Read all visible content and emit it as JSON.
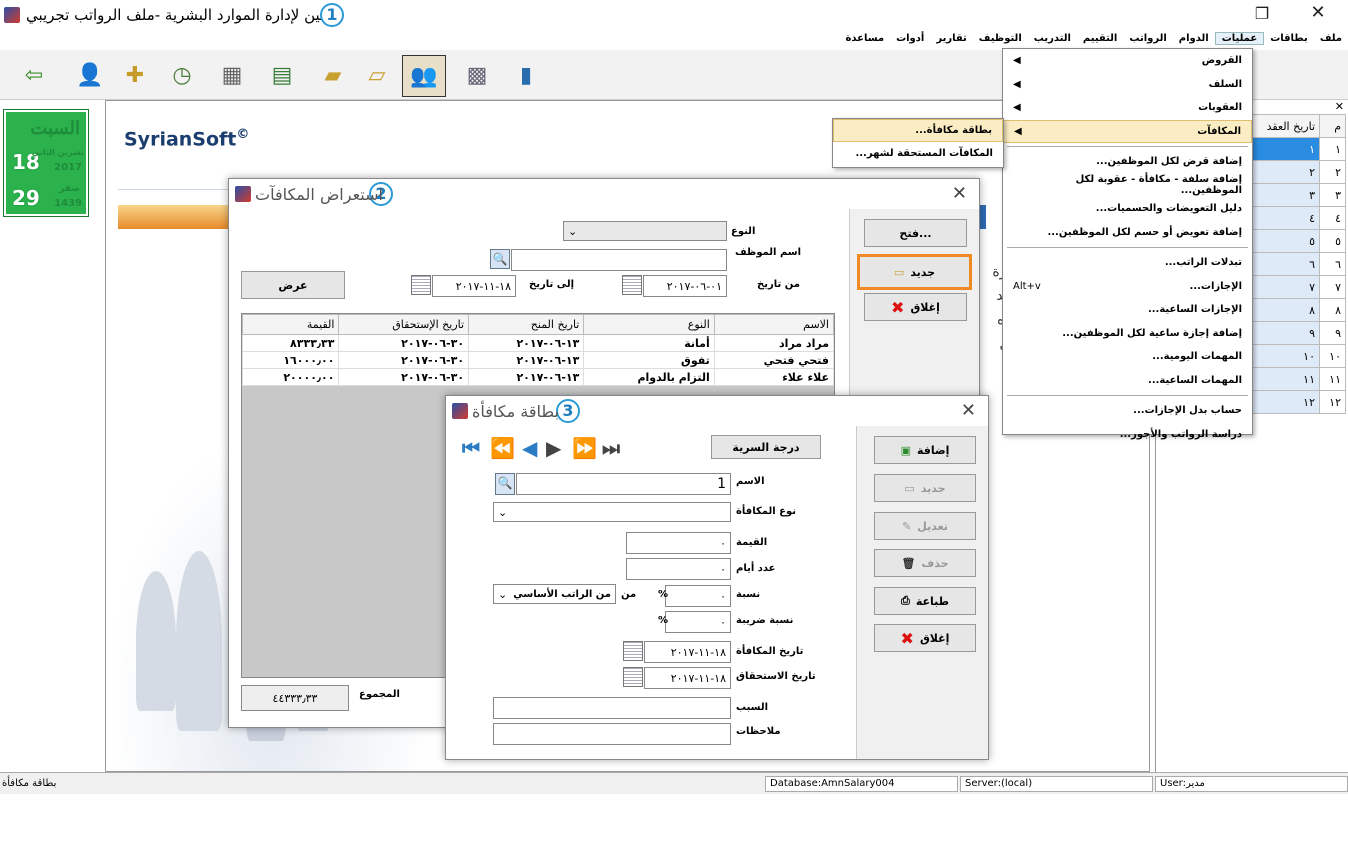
{
  "window": {
    "title": "الأمين لإدارة الموارد البشرية -ملف الرواتب تجريبي",
    "badge": "1"
  },
  "menubar": [
    "ملف",
    "بطاقات",
    "عمليات",
    "الدوام",
    "الرواتب",
    "التقييم",
    "التدريب",
    "التوظيف",
    "تقارير",
    "أدوات",
    "مساعدة"
  ],
  "calendar": {
    "day_name": "السبت",
    "greg_day": "18",
    "greg_month": "تشرين الثاني",
    "greg_year": "2017",
    "hijri_day": "29",
    "hijri_month": "صفر",
    "hijri_year": "1439"
  },
  "brand": {
    "name": "SyrianSoft",
    "mark": "©"
  },
  "ops_menu": {
    "items": [
      {
        "label": "القروض",
        "submenu": true
      },
      {
        "label": "السلف",
        "submenu": true
      },
      {
        "label": "العقوبات",
        "submenu": true
      },
      {
        "label": "المكافآت",
        "submenu": true
      },
      {
        "label": "إضافة قرض لكل الموظفين..."
      },
      {
        "label": "إضافة سلفة - مكافأة - عقوبة لكل الموظفين..."
      },
      {
        "label": "دليل التعويضات والحسميات..."
      },
      {
        "label": "إضافة تعويض أو حسم لكل الموظفين..."
      },
      {
        "label": "تبدلات الراتب..."
      },
      {
        "label": "الإجازات...",
        "shortcut": "Alt+v"
      },
      {
        "label": "الإجازات الساعية..."
      },
      {
        "label": "إضافة إجازة ساعية لكل الموظفين..."
      },
      {
        "label": "المهمات اليومية..."
      },
      {
        "label": "المهمات الساعية..."
      },
      {
        "label": "حساب بدل الإجازات..."
      },
      {
        "label": "دراسة الرواتب والأجور..."
      }
    ]
  },
  "rewards_submenu": [
    "بطاقة مكافأة...",
    "المكافآت المستحقة لشهر..."
  ],
  "right_grid": {
    "headers": [
      "م",
      "تاريخ العقد"
    ],
    "rows": [
      [
        "١",
        "١"
      ],
      [
        "٢",
        "٢"
      ],
      [
        "٣",
        "٣"
      ],
      [
        "٤",
        "٤"
      ],
      [
        "٥",
        "٥"
      ],
      [
        "٦",
        "٦"
      ],
      [
        "٧",
        "٧"
      ],
      [
        "٨",
        "٨"
      ],
      [
        "٩",
        "٩"
      ],
      [
        "١٠",
        "١٠"
      ],
      [
        "١١",
        "١١"
      ],
      [
        "١٢",
        "١٢"
      ]
    ]
  },
  "browse_dialog": {
    "title": "استعراض المكافآت",
    "badge": "2",
    "labels": {
      "type": "النوع",
      "employee": "اسم الموظف",
      "from_date": "من تاريخ",
      "to_date": "إلى تاريخ",
      "total": "المجموع"
    },
    "from_date": "٠١-٠٦-٢٠١٧",
    "to_date": "١٨-١١-٢٠١٧",
    "buttons": {
      "open": "فتح...",
      "new": "جديد",
      "close": "إغلاق",
      "show": "عرض"
    },
    "columns": [
      "الاسم",
      "النوع",
      "تاريخ المنح",
      "تاريخ الإستحقاق",
      "القيمة"
    ],
    "rows": [
      [
        "مراد مراد",
        "أمانة",
        "١٣-٠٦-٢٠١٧",
        "٣٠-٠٦-٢٠١٧",
        "٨٣٣٣٫٣٣"
      ],
      [
        "فتحي فتحي",
        "تفوق",
        "١٣-٠٦-٢٠١٧",
        "٣٠-٠٦-٢٠١٧",
        "١٦٠٠٠٫٠٠"
      ],
      [
        "علاء علاء",
        "التزام بالدوام",
        "١٣-٠٦-٢٠١٧",
        "٣٠-٠٦-٢٠١٧",
        "٢٠٠٠٠٫٠٠"
      ]
    ],
    "total": "٤٤٣٣٣٫٣٣",
    "partial_bg_text": [
      "ن با",
      "ن ترة",
      "ن مد",
      "ون ه",
      "ة لل"
    ]
  },
  "card_dialog": {
    "title": "بطاقة مكافأة",
    "badge": "3",
    "secrecy_btn": "درجة السرية",
    "labels": {
      "name": "الاسم",
      "reward_type": "نوع المكافأة",
      "value": "القيمة",
      "days": "عدد أيام",
      "ratio": "نسبة",
      "from": "من",
      "tax_ratio": "نسبة ضريبة",
      "reward_date": "تاريخ المكافأة",
      "due_date": "تاريخ الاستحقاق",
      "reason": "السبب",
      "notes": "ملاحظات"
    },
    "name_value": "1",
    "value": "٠",
    "days": "٠",
    "ratio": "٠",
    "tax_ratio": "٠",
    "percent": "%",
    "base_select": "من الراتب الأساسي",
    "reward_date": "١٨-١١-٢٠١٧",
    "due_date": "١٨-١١-٢٠١٧",
    "buttons": {
      "add": "إضافة",
      "new": "جديد",
      "edit": "تعديل",
      "delete": "حذف",
      "print": "طباعة",
      "close": "إغلاق"
    }
  },
  "status": {
    "left": "بطاقة مكافأة",
    "database": "Database:AmnSalary004",
    "server": "Server:(local)",
    "user": "User:مدير"
  },
  "colors": {
    "accent": "#2c9ad6",
    "highlight": "#fbedc3",
    "new_outline": "#f08a24",
    "calendar_green": "#2bb24c"
  }
}
